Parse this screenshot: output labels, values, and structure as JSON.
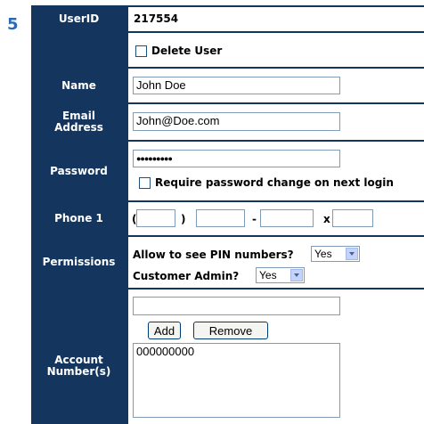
{
  "step_number": "5",
  "user_id": {
    "label": "UserID",
    "value": "217554"
  },
  "delete_user": {
    "label": "Delete User"
  },
  "name": {
    "label": "Name",
    "value": "John Doe"
  },
  "email": {
    "label_line1": "Email",
    "label_line2": "Address",
    "value": "John@Doe.com"
  },
  "password": {
    "label": "Password",
    "value": "●●●●●●●●●",
    "require_change_label": "Require password change on next login"
  },
  "phone": {
    "label": "Phone 1",
    "open_paren": "(",
    "close_paren": ")",
    "dash": "-",
    "ext": "x"
  },
  "permissions": {
    "label": "Permissions",
    "pin_label": "Allow to see PIN numbers?",
    "pin_value": "Yes",
    "admin_label": "Customer Admin?",
    "admin_value": "Yes"
  },
  "accounts": {
    "label_line1": "Account",
    "label_line2": "Number(s)",
    "add_label": "Add",
    "remove_label": "Remove",
    "items": [
      "000000000"
    ]
  },
  "colors": {
    "label_bg": "#14365e",
    "step": "#2b6ab5"
  }
}
